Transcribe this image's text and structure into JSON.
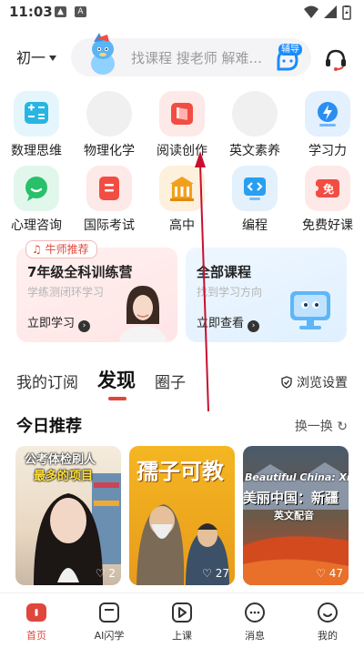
{
  "status_bar": {
    "time": "11:03",
    "left_icons": [
      "image-icon",
      "text-a-icon"
    ],
    "right_icons": [
      "wifi-icon",
      "signal-icon",
      "battery-icon"
    ]
  },
  "header": {
    "grade_selector": "初一",
    "search_placeholder": "找课程 搜老师 解难...",
    "tutor_badge": "辅导",
    "support_icon": "headset-icon"
  },
  "categories": [
    {
      "label": "数理思维",
      "icon": "math-icon",
      "color": "#27b5e3"
    },
    {
      "label": "物理化学",
      "icon": "blank-icon",
      "color": "#eeeeee"
    },
    {
      "label": "阅读创作",
      "icon": "book-icon",
      "color": "#f24d42"
    },
    {
      "label": "英文素养",
      "icon": "blank-icon",
      "color": "#eeeeee"
    },
    {
      "label": "学习力",
      "icon": "lightning-icon",
      "color": "#2a8ff0"
    },
    {
      "label": "心理咨询",
      "icon": "chat-bubble-icon",
      "color": "#28c06a"
    },
    {
      "label": "国际考试",
      "icon": "exam-icon",
      "color": "#f24d42"
    },
    {
      "label": "高中",
      "icon": "building-icon",
      "color": "#f2a01c"
    },
    {
      "label": "编程",
      "icon": "code-icon",
      "color": "#2a9ff0"
    },
    {
      "label": "免费好课",
      "icon": "free-ticket-icon",
      "color": "#f24d42"
    }
  ],
  "promos": {
    "left": {
      "tag": "牛师推荐",
      "title": "7年级全科训练营",
      "subtitle": "学练测闭环学习",
      "cta": "立即学习"
    },
    "right": {
      "title": "全部课程",
      "subtitle": "找到学习方向",
      "cta": "立即查看"
    }
  },
  "feed_tabs": {
    "tabs": [
      "我的订阅",
      "发现",
      "圈子"
    ],
    "active": "发现",
    "settings": "浏览设置"
  },
  "recommend": {
    "title": "今日推荐",
    "refresh": "换一换",
    "cards": [
      {
        "overlay_text_1": "公考体检刷人",
        "overlay_text_2": "最多的项目",
        "likes": "2"
      },
      {
        "overlay_text_1": "孺子可教",
        "overlay_text_2": "",
        "likes": "27"
      },
      {
        "overlay_text_1": "Beautiful China: Xinjiang",
        "overlay_text_2": "美丽中国：新疆",
        "overlay_text_3": "英文配音",
        "likes": "47"
      }
    ]
  },
  "bottom_nav": [
    {
      "label": "首页",
      "icon": "home-icon",
      "active": true
    },
    {
      "label": "AI闪学",
      "icon": "ai-learn-icon",
      "active": false
    },
    {
      "label": "上课",
      "icon": "play-class-icon",
      "active": false
    },
    {
      "label": "消息",
      "icon": "message-icon",
      "active": false
    },
    {
      "label": "我的",
      "icon": "profile-icon",
      "active": false
    }
  ],
  "colors": {
    "accent": "#e0463c",
    "search_bg": "#f4f4f6",
    "tutor_blue": "#1a8cff"
  }
}
